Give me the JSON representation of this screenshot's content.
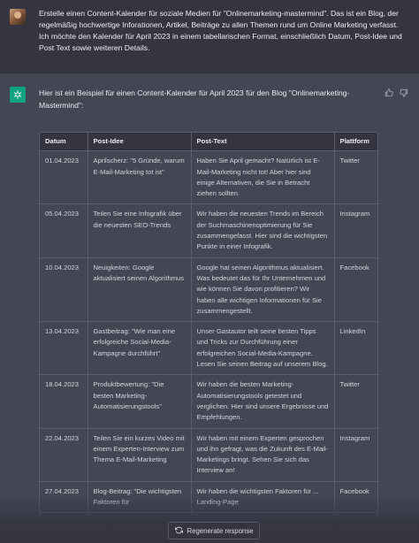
{
  "user_message": {
    "text": "Erstelle einen Content-Kalender für soziale Medien für \"Onlinemarketing-mastermind\". Das ist ein Blog, der regelmäßig hochwertige Inforationen, Artikel, Beiträge zu allen Themen rund um Online Marketing verfasst. Ich möchte den Kalender für April 2023 in einem tabellarischen Format, einschließlich Datum, Post-Idee und Post Text sowie weiteren Details."
  },
  "assistant_message": {
    "intro": "Hier ist ein Beispiel für einen Content-Kalender für April 2023 für den Blog \"Onlinemarketing-Mastermind\":",
    "table": {
      "headers": [
        "Datum",
        "Post-Idee",
        "Post-Text",
        "Plattform"
      ],
      "rows": [
        [
          "01.04.2023",
          "Aprilscherz: \"5 Gründe, warum E-Mail-Marketing tot ist\"",
          "Haben Sie April gemacht? Natürlich ist E-Mail-Marketing nicht tot! Aber hier sind einige Alternativen, die Sie in Betracht ziehen sollten.",
          "Twitter"
        ],
        [
          "05.04.2023",
          "Teilen Sie eine Infografik über die neuesten SEO-Trends",
          "Wir haben die neuesten Trends im Bereich der Suchmaschinenoptimierung für Sie zusammengefasst. Hier sind die wichtigsten Punkte in einer Infografik.",
          "Instagram"
        ],
        [
          "10.04.2023",
          "Neuigkeiten: Google aktualisiert seinen Algorithmus",
          "Google hat seinen Algorithmus aktualisiert. Was bedeutet das für Ihr Unternehmen und wie können Sie davon profitieren? Wir haben alle wichtigen Informationen für Sie zusammengestellt.",
          "Facebook"
        ],
        [
          "13.04.2023",
          "Gastbeitrag: \"Wie man eine erfolgreiche Social-Media-Kampagne durchführt\"",
          "Unser Gastautor teilt seine besten Tipps und Tricks zur Durchführung einer erfolgreichen Social-Media-Kampagne. Lesen Sie seinen Beitrag auf unserem Blog.",
          "LinkedIn"
        ],
        [
          "18.04.2023",
          "Produktbewertung: \"Die besten Marketing-Automatisierungstools\"",
          "Wir haben die besten Marketing-Automatisierungstools getestet und verglichen. Hier sind unsere Ergebnisse und Empfehlungen.",
          "Twitter"
        ],
        [
          "22.04.2023",
          "Teilen Sie ein kurzes Video mit einem Experten-Interview zum Thema E-Mail-Marketing",
          "Wir haben mit einem Experten gesprochen und ihn gefragt, was die Zukunft des E-Mail-Marketings bringt. Sehen Sie sich das Interview an!",
          "Instagram"
        ],
        [
          "27.04.2023",
          "Blog-Beitrag: \"Die wichtigsten Faktoren für",
          "Wir haben die wichtigsten Faktoren für ... Landing-Page",
          "Facebook"
        ]
      ]
    }
  },
  "regenerate": {
    "label": "Regenerate response"
  },
  "colors": {
    "user_bg": "#343541",
    "assistant_bg": "#444654",
    "gpt_green": "#10a37f",
    "text": "#ececf1",
    "border": "#5c5e6c"
  },
  "icons": [
    "user-avatar",
    "chatgpt-logo-icon",
    "thumbs-up-icon",
    "thumbs-down-icon",
    "refresh-icon"
  ]
}
